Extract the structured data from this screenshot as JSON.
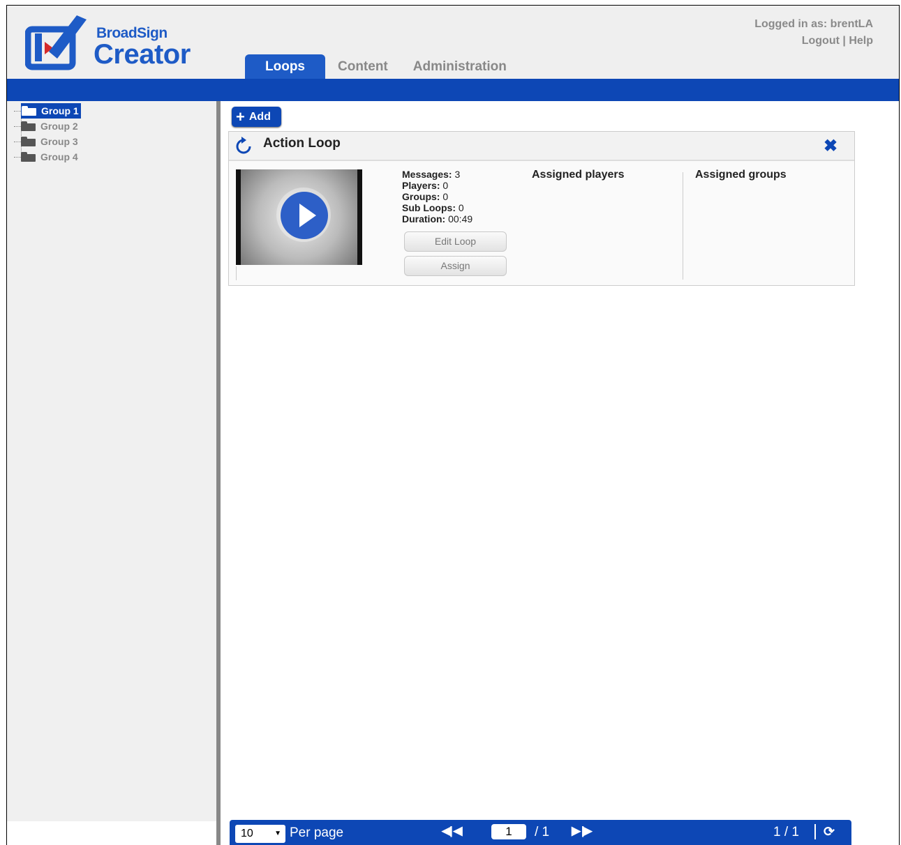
{
  "header": {
    "brand_small": "BroadSign",
    "brand_big": "Creator",
    "logged_in": "Logged in as: brentLA",
    "logout": "Logout",
    "separator": "|",
    "help": "Help"
  },
  "tabs": [
    {
      "label": "Loops",
      "active": true
    },
    {
      "label": "Content",
      "active": false
    },
    {
      "label": "Administration",
      "active": false
    }
  ],
  "sidebar": {
    "groups": [
      {
        "label": "Group 1",
        "selected": true
      },
      {
        "label": "Group 2",
        "selected": false
      },
      {
        "label": "Group 3",
        "selected": false
      },
      {
        "label": "Group 4",
        "selected": false
      }
    ]
  },
  "toolbar": {
    "add_label": "Add",
    "add_icon": "plus-icon"
  },
  "loop": {
    "title": "Action Loop",
    "stats": {
      "messages_label": "Messages:",
      "messages": "3",
      "players_label": "Players:",
      "players": "0",
      "groups_label": "Groups:",
      "groups": "0",
      "subloops_label": "Sub Loops:",
      "subloops": "0",
      "duration_label": "Duration:",
      "duration": "00:49"
    },
    "edit_label": "Edit Loop",
    "assign_label": "Assign",
    "assigned_players_label": "Assigned players",
    "assigned_groups_label": "Assigned groups"
  },
  "pager": {
    "per_page_value": "10",
    "per_page_label": "Per page",
    "current_page": "1",
    "total_pages": "/ 1",
    "page_count": "1 / 1"
  },
  "colors": {
    "accent": "#0d47b5",
    "brand": "#1e5bc6"
  }
}
